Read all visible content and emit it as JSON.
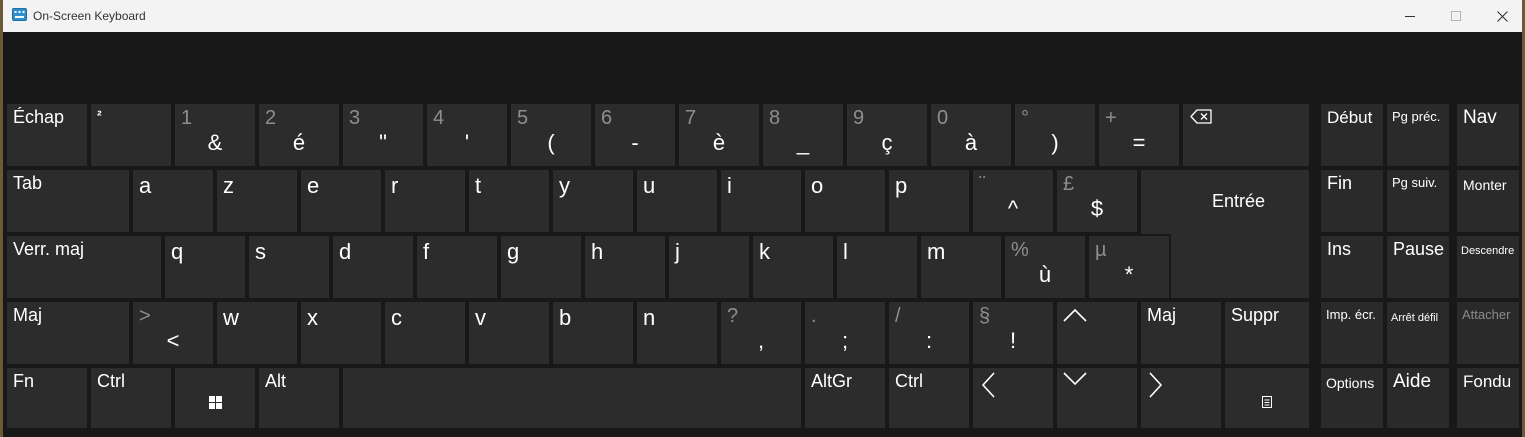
{
  "window": {
    "title": "On-Screen Keyboard"
  },
  "keys": {
    "escape": "Échap",
    "square": "²",
    "d1": {
      "top": "1",
      "main": "&"
    },
    "d2": {
      "top": "2",
      "main": "é"
    },
    "d3": {
      "top": "3",
      "main": "\""
    },
    "d4": {
      "top": "4",
      "main": "'"
    },
    "d5": {
      "top": "5",
      "main": "("
    },
    "d6": {
      "top": "6",
      "main": "-"
    },
    "d7": {
      "top": "7",
      "main": "è"
    },
    "d8": {
      "top": "8",
      "main": "_"
    },
    "d9": {
      "top": "9",
      "main": "ç"
    },
    "d0": {
      "top": "0",
      "main": "à"
    },
    "deg": {
      "top": "°",
      "main": ")"
    },
    "plus": {
      "top": "+",
      "main": "="
    },
    "tab": "Tab",
    "a": "a",
    "z": "z",
    "e": "e",
    "r": "r",
    "t": "t",
    "y": "y",
    "u": "u",
    "i": "i",
    "o": "o",
    "p": "p",
    "circ": {
      "top": "¨",
      "main": "^"
    },
    "dollar": {
      "top": "£",
      "main": "$"
    },
    "enter": "Entrée",
    "caps": "Verr. maj",
    "q": "q",
    "s": "s",
    "d": "d",
    "f": "f",
    "g": "g",
    "h": "h",
    "j": "j",
    "k": "k",
    "l": "l",
    "m": "m",
    "ugrave": {
      "top": "%",
      "main": "ù"
    },
    "star": {
      "top": "µ",
      "main": "*"
    },
    "lshift": "Maj",
    "lt": {
      "top": ">",
      "main": "<"
    },
    "w": "w",
    "x": "x",
    "c": "c",
    "v": "v",
    "b": "b",
    "n": "n",
    "comma": {
      "top": "?",
      "main": ","
    },
    "semicolon": {
      "top": ".",
      "main": ";"
    },
    "colon": {
      "top": "/",
      "main": ":"
    },
    "excl": {
      "top": "§",
      "main": "!"
    },
    "rshift": "Maj",
    "delete": "Suppr",
    "fn": "Fn",
    "lctrl": "Ctrl",
    "alt": "Alt",
    "altgr": "AltGr",
    "rctrl": "Ctrl"
  },
  "nav_keys": {
    "home": "Début",
    "pgup": "Pg préc.",
    "nav": "Nav",
    "end": "Fin",
    "pgdn": "Pg suiv.",
    "moveup": "Monter",
    "ins": "Ins",
    "pause": "Pause",
    "movedown": "Descendre",
    "prtscr": "Imp. écr.",
    "scrlk": "Arrêt défil",
    "dock": "Attacher",
    "options": "Options",
    "help": "Aide",
    "fade": "Fondu"
  },
  "icons": {
    "app": "keyboard-icon",
    "backspace": "backspace-icon",
    "windows": "windows-logo-icon",
    "up": "up-arrow-icon",
    "down": "down-arrow-icon",
    "left": "left-arrow-icon",
    "right": "right-arrow-icon",
    "menu": "context-menu-icon"
  },
  "colors": {
    "key": "#2c2c2c",
    "background": "#181818",
    "titlebar": "#f3f3f3",
    "dim_text": "#8e8e8e"
  }
}
